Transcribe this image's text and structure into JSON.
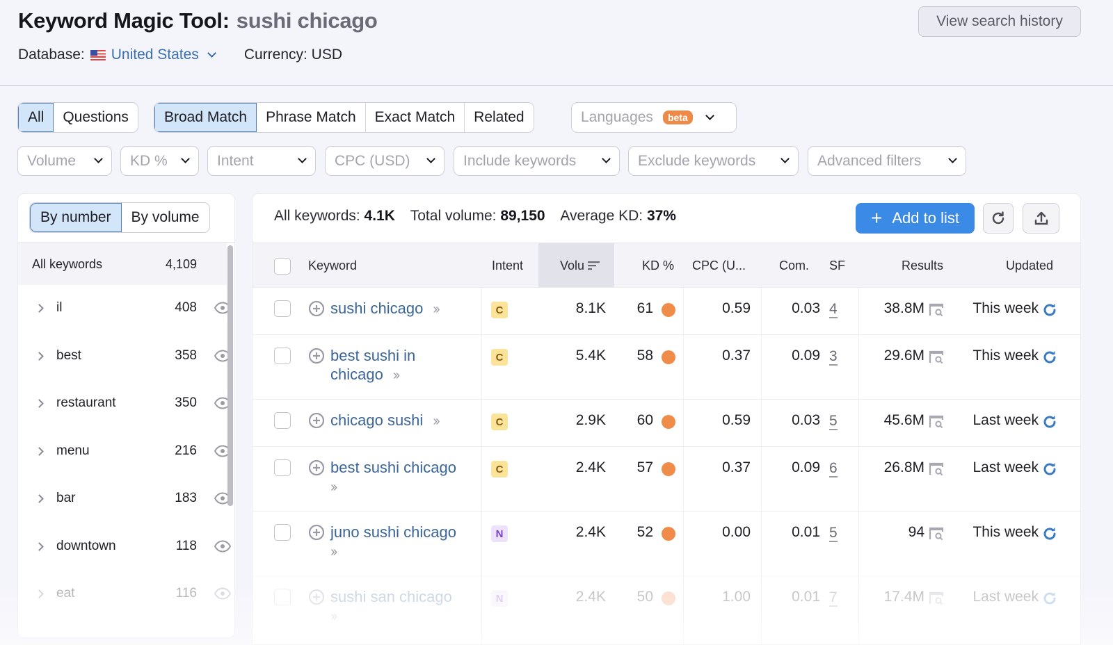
{
  "header": {
    "title": "Keyword Magic Tool:",
    "query": "sushi chicago",
    "database_label": "Database:",
    "database_value": "United States",
    "currency": "Currency: USD",
    "history_button": "View search history"
  },
  "tabs_type": [
    {
      "label": "All",
      "active": true
    },
    {
      "label": "Questions",
      "active": false
    }
  ],
  "tabs_match": [
    {
      "label": "Broad Match",
      "active": true
    },
    {
      "label": "Phrase Match",
      "active": false
    },
    {
      "label": "Exact Match",
      "active": false
    },
    {
      "label": "Related",
      "active": false
    }
  ],
  "languages": {
    "placeholder": "Languages",
    "badge": "beta"
  },
  "filters": [
    "Volume",
    "KD %",
    "Intent",
    "CPC (USD)",
    "Include keywords",
    "Exclude keywords",
    "Advanced filters"
  ],
  "groups_panel": {
    "toggle": [
      {
        "label": "By number",
        "active": true
      },
      {
        "label": "By volume",
        "active": false
      }
    ],
    "all_keywords": {
      "label": "All keywords",
      "count": "4,109"
    },
    "groups": [
      {
        "label": "il",
        "count": "408"
      },
      {
        "label": "best",
        "count": "358"
      },
      {
        "label": "restaurant",
        "count": "350"
      },
      {
        "label": "menu",
        "count": "216"
      },
      {
        "label": "bar",
        "count": "183"
      },
      {
        "label": "downtown",
        "count": "118"
      },
      {
        "label": "eat",
        "count": "116"
      }
    ]
  },
  "summary": {
    "all_keywords_label": "All keywords:",
    "all_keywords_value": "4.1K",
    "total_volume_label": "Total volume:",
    "total_volume_value": "89,150",
    "avg_kd_label": "Average KD:",
    "avg_kd_value": "37%",
    "add_button": "Add to list",
    "accent_color": "#3a8ae6"
  },
  "table": {
    "columns": [
      "Keyword",
      "Intent",
      "Volu",
      "KD %",
      "CPC (U...",
      "Com.",
      "SF",
      "Results",
      "Updated"
    ],
    "rows": [
      {
        "keyword_lines": [
          "sushi chicago"
        ],
        "intent": "C",
        "volume": "8.1K",
        "kd": "61",
        "cpc": "0.59",
        "com": "0.03",
        "sf": "4",
        "results": "38.8M",
        "updated": "This week"
      },
      {
        "keyword_lines": [
          "best sushi in",
          "chicago"
        ],
        "intent": "C",
        "volume": "5.4K",
        "kd": "58",
        "cpc": "0.37",
        "com": "0.09",
        "sf": "3",
        "results": "29.6M",
        "updated": "This week"
      },
      {
        "keyword_lines": [
          "chicago sushi"
        ],
        "intent": "C",
        "volume": "2.9K",
        "kd": "60",
        "cpc": "0.59",
        "com": "0.03",
        "sf": "5",
        "results": "45.6M",
        "updated": "Last week"
      },
      {
        "keyword_lines": [
          "best sushi chicago",
          ""
        ],
        "intent": "C",
        "volume": "2.4K",
        "kd": "57",
        "cpc": "0.37",
        "com": "0.09",
        "sf": "6",
        "results": "26.8M",
        "updated": "Last week"
      },
      {
        "keyword_lines": [
          "juno sushi chicago",
          ""
        ],
        "intent": "N",
        "volume": "2.4K",
        "kd": "52",
        "cpc": "0.00",
        "com": "0.01",
        "sf": "5",
        "results": "94",
        "updated": "This week"
      },
      {
        "keyword_lines": [
          "sushi san chicago",
          ""
        ],
        "intent": "N",
        "volume": "2.4K",
        "kd": "50",
        "cpc": "1.00",
        "com": "0.01",
        "sf": "7",
        "results": "17.4M",
        "updated": "Last week"
      }
    ]
  }
}
